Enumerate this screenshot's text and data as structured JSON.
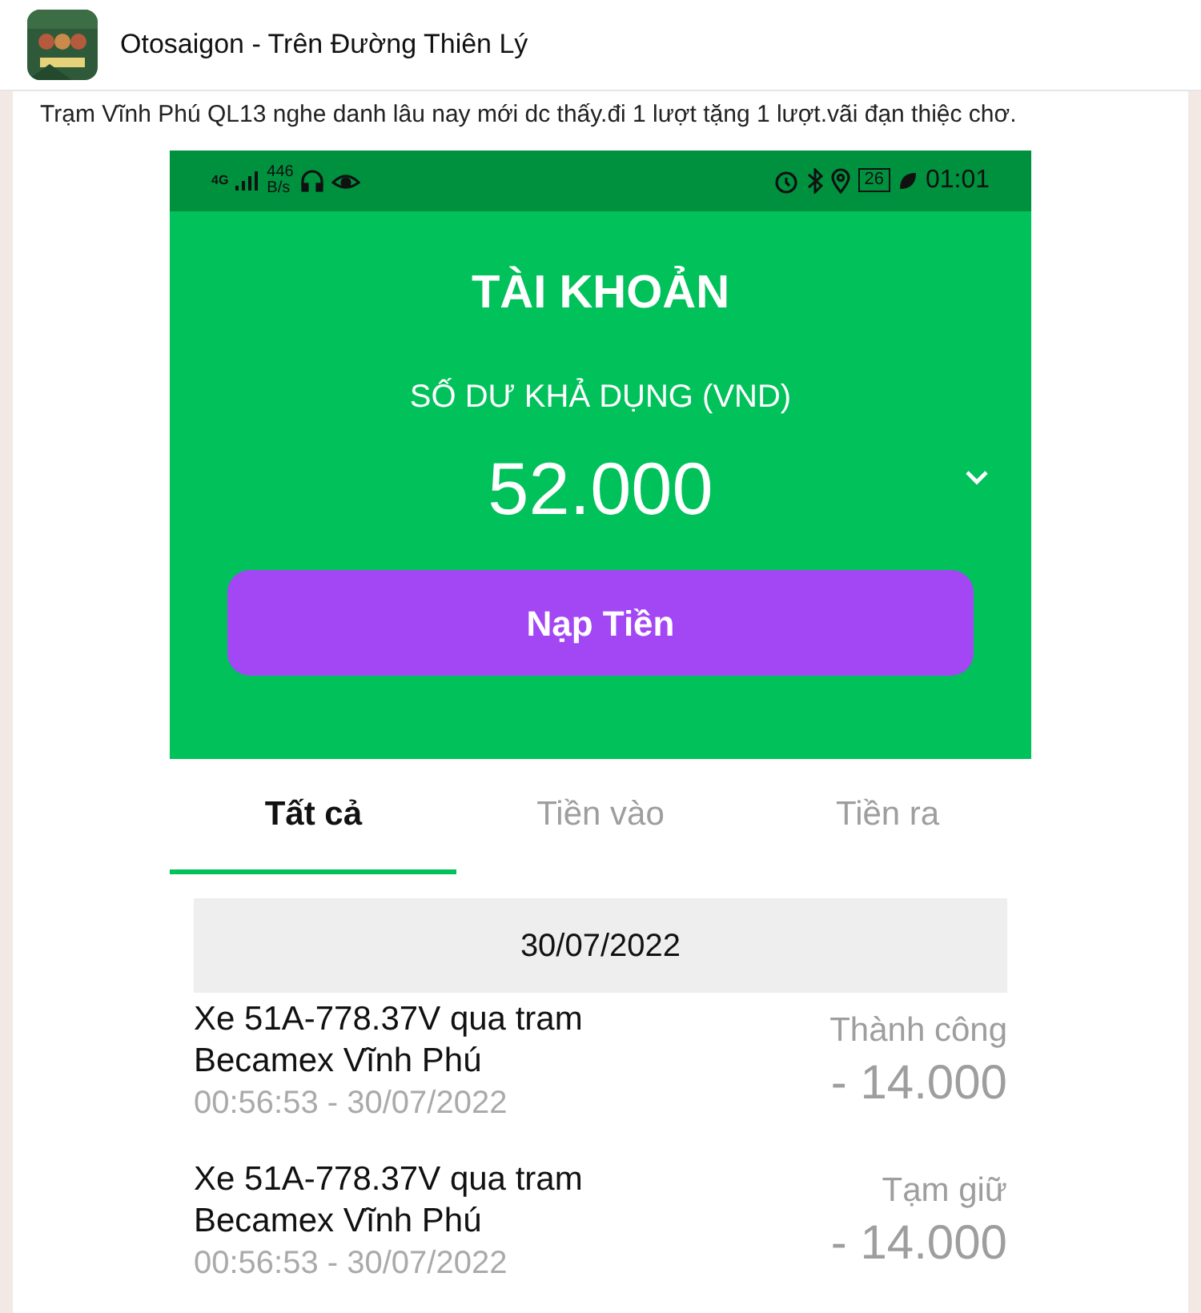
{
  "header": {
    "title": "Otosaigon - Trên Đường Thiên Lý"
  },
  "post": {
    "text": "Trạm Vĩnh Phú QL13 nghe danh lâu nay mới dc thấy.đi 1 lượt tặng 1 lượt.vãi đạn thiệc chơ."
  },
  "status_bar": {
    "network": "4G",
    "speed": "446",
    "speed_unit": "B/s",
    "battery": "26",
    "time": "01:01"
  },
  "account": {
    "title": "TÀI KHOẢN",
    "balance_label": "SỐ DƯ KHẢ DỤNG (VND)",
    "balance": "52.000",
    "topup_button": "Nạp Tiền"
  },
  "tabs": [
    {
      "label": "Tất cả",
      "selected": true
    },
    {
      "label": "Tiền vào",
      "selected": false
    },
    {
      "label": "Tiền ra",
      "selected": false
    }
  ],
  "date_header": "30/07/2022",
  "transactions": [
    {
      "title": "Xe 51A-778.37V qua tram Becamex Vĩnh Phú",
      "time": "00:56:53 - 30/07/2022",
      "status": "Thành công",
      "amount": "- 14.000"
    },
    {
      "title": "Xe 51A-778.37V qua tram Becamex Vĩnh Phú",
      "time": "00:56:53 - 30/07/2022",
      "status": "Tạm giữ",
      "amount": "- 14.000"
    }
  ]
}
